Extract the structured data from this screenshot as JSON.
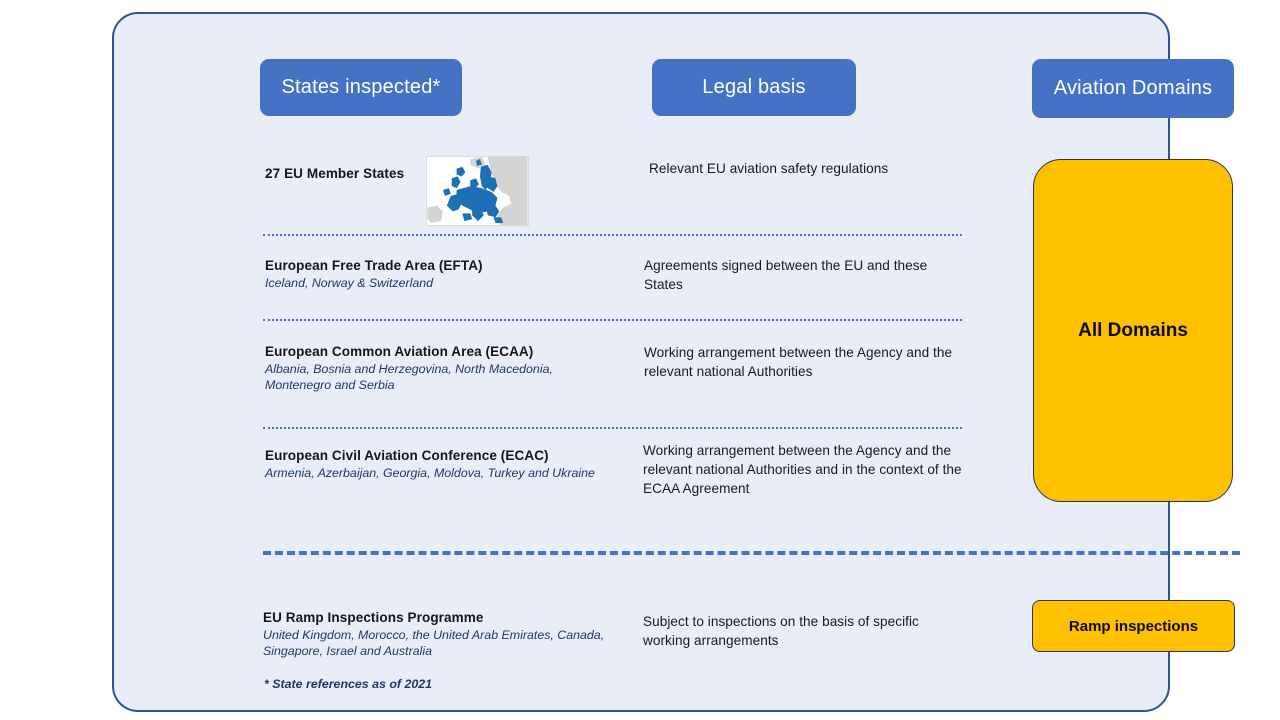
{
  "header": {
    "states_label": "States inspected*",
    "legal_label": "Legal basis",
    "domains_label": "Aviation Domains"
  },
  "rows": [
    {
      "title": "27 EU Member States",
      "subtitle": "",
      "legal": "Relevant EU aviation safety regulations",
      "has_map": true
    },
    {
      "title": "European Free Trade Area (EFTA)",
      "subtitle": "Iceland, Norway & Switzerland",
      "legal": "Agreements signed between the EU and these States",
      "has_map": false
    },
    {
      "title": "European Common Aviation Area (ECAA)",
      "subtitle": "Albania, Bosnia and Herzegovina, North Macedonia, Montenegro and Serbia",
      "legal": "Working arrangement between the Agency and the relevant national Authorities",
      "has_map": false
    },
    {
      "title": "European Civil Aviation Conference (ECAC)",
      "subtitle": "Armenia, Azerbaijan, Georgia, Moldova, Turkey and Ukraine",
      "legal": "Working arrangement between the Agency and the relevant national Authorities and in the context of the ECAA Agreement",
      "has_map": false
    }
  ],
  "bottom_row": {
    "title": "EU Ramp Inspections Programme",
    "subtitle": "United Kingdom, Morocco, the United Arab Emirates, Canada, Singapore, Israel and Australia",
    "legal": "Subject to inspections on the basis of specific working arrangements"
  },
  "domains": {
    "all_domains_label": "All Domains",
    "ramp_inspections_label": "Ramp inspections"
  },
  "footnote": "* State references as of 2021",
  "colors": {
    "panel_background": "#e8edf7",
    "panel_border": "#2f5496",
    "header_button": "#4472c4",
    "domain_box": "#ffc000",
    "domain_box_border": "#1f3864",
    "divider": "#4472c4",
    "subtitle_text": "#1f3864",
    "map_highlight": "#1f6fb4",
    "map_base": "#d4d4d4"
  }
}
